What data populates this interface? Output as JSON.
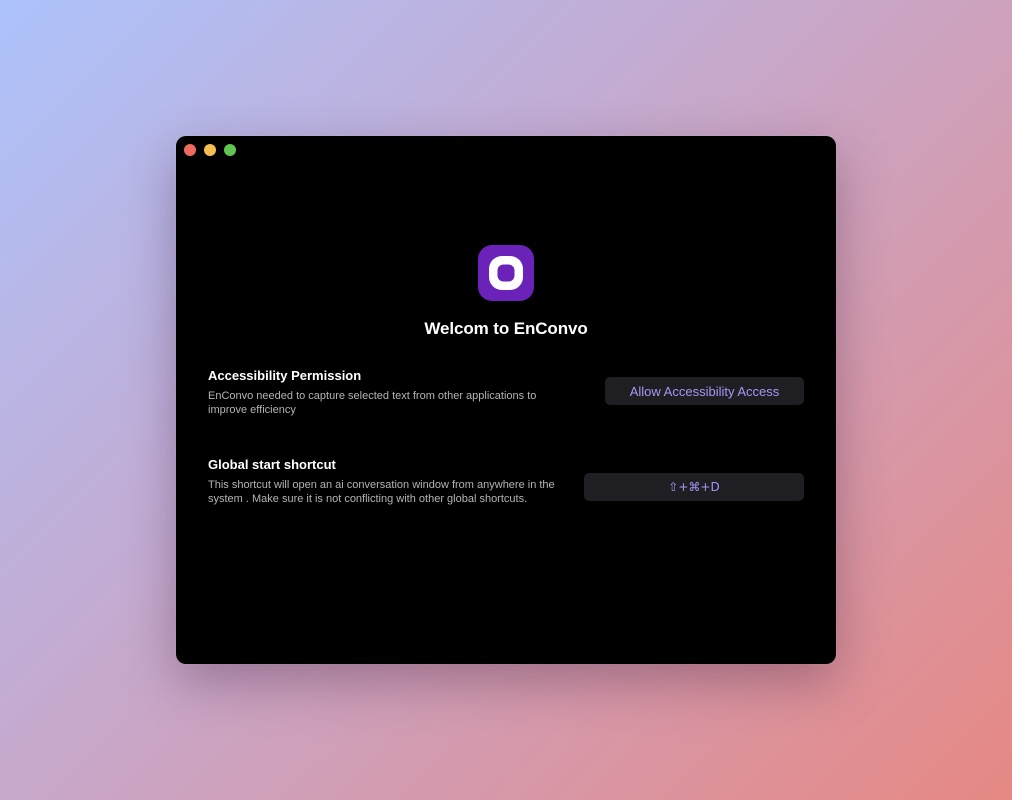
{
  "window": {
    "traffic_lights": [
      {
        "name": "close",
        "color": "#ec6a5e"
      },
      {
        "name": "minimize",
        "color": "#f4bf4f"
      },
      {
        "name": "maximize",
        "color": "#61c554"
      }
    ]
  },
  "app": {
    "icon": "enconvo-logo-icon",
    "icon_color": "#6a22b8",
    "title": "Welcom to EnConvo"
  },
  "accessibility": {
    "title": "Accessibility Permission",
    "description": "EnConvo needed to capture selected text from other applications to improve efficiency",
    "button_label": "Allow Accessibility Access"
  },
  "shortcut": {
    "title": "Global start shortcut",
    "description": "This shortcut will open an ai conversation window from anywhere in the system . Make sure it is not conflicting with other global shortcuts.",
    "value": "⇧+⌘+D"
  },
  "colors": {
    "accent_text": "#a497f3",
    "button_bg": "#1f1f23",
    "window_bg": "#000000"
  }
}
